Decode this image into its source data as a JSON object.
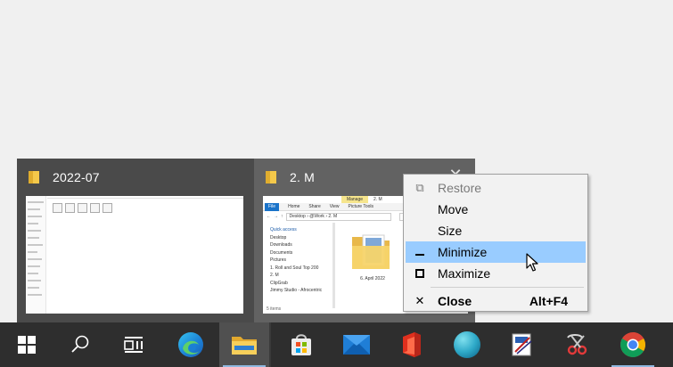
{
  "thumbnails": [
    {
      "title": "2022-07"
    },
    {
      "title": "2. M",
      "close_glyph": "✕",
      "preview": {
        "manage_tab": "Manage",
        "drive_label": "2. M",
        "ribbon_tabs": [
          "File",
          "Home",
          "Share",
          "View",
          "Picture Tools"
        ],
        "address": "Desktop › @Work › 2. M",
        "tree_items": [
          "Quick access",
          "Desktop",
          "Downloads",
          "Documents",
          "Pictures",
          "1. Roll and Soul Top 200",
          "2. M",
          "ClipGrab",
          "Jimmy Studio - Afrocentric"
        ],
        "folder_caption": "6. April 2022",
        "status": "5 items"
      }
    }
  ],
  "context_menu": {
    "items": [
      {
        "label": "Restore",
        "icon": "restore-icon",
        "glyph": "⧉",
        "enabled": false
      },
      {
        "label": "Move",
        "enabled": true
      },
      {
        "label": "Size",
        "enabled": true
      },
      {
        "label": "Minimize",
        "icon": "minimize-icon",
        "glyph": "–",
        "enabled": true,
        "highlighted": true
      },
      {
        "label": "Maximize",
        "icon": "maximize-icon",
        "glyph": "□",
        "enabled": true
      },
      {
        "label": "Close",
        "icon": "close-icon",
        "glyph": "✕",
        "shortcut": "Alt+F4",
        "enabled": true,
        "bold": true
      }
    ]
  },
  "taskbar": {
    "buttons": [
      {
        "name": "start",
        "icon": "windows-logo-icon"
      },
      {
        "name": "search",
        "icon": "search-icon"
      },
      {
        "name": "task-view",
        "icon": "task-view-icon"
      },
      {
        "name": "edge",
        "icon": "edge-icon"
      },
      {
        "name": "file-explorer",
        "icon": "file-explorer-icon",
        "active": true
      },
      {
        "name": "store",
        "icon": "store-icon"
      },
      {
        "name": "mail",
        "icon": "mail-icon"
      },
      {
        "name": "office",
        "icon": "office-icon"
      },
      {
        "name": "app-circle",
        "icon": "blue-circle-app-icon"
      },
      {
        "name": "paint-app",
        "icon": "paint-app-icon"
      },
      {
        "name": "snipping-tool",
        "icon": "snipping-tool-icon"
      },
      {
        "name": "chrome",
        "icon": "chrome-icon",
        "running": true
      }
    ]
  },
  "colors": {
    "taskbar": "#2e2e2e",
    "menu_highlight": "#99ccff",
    "folder_yellow": "#f4c84a",
    "accent_blue": "#1a73c9"
  }
}
